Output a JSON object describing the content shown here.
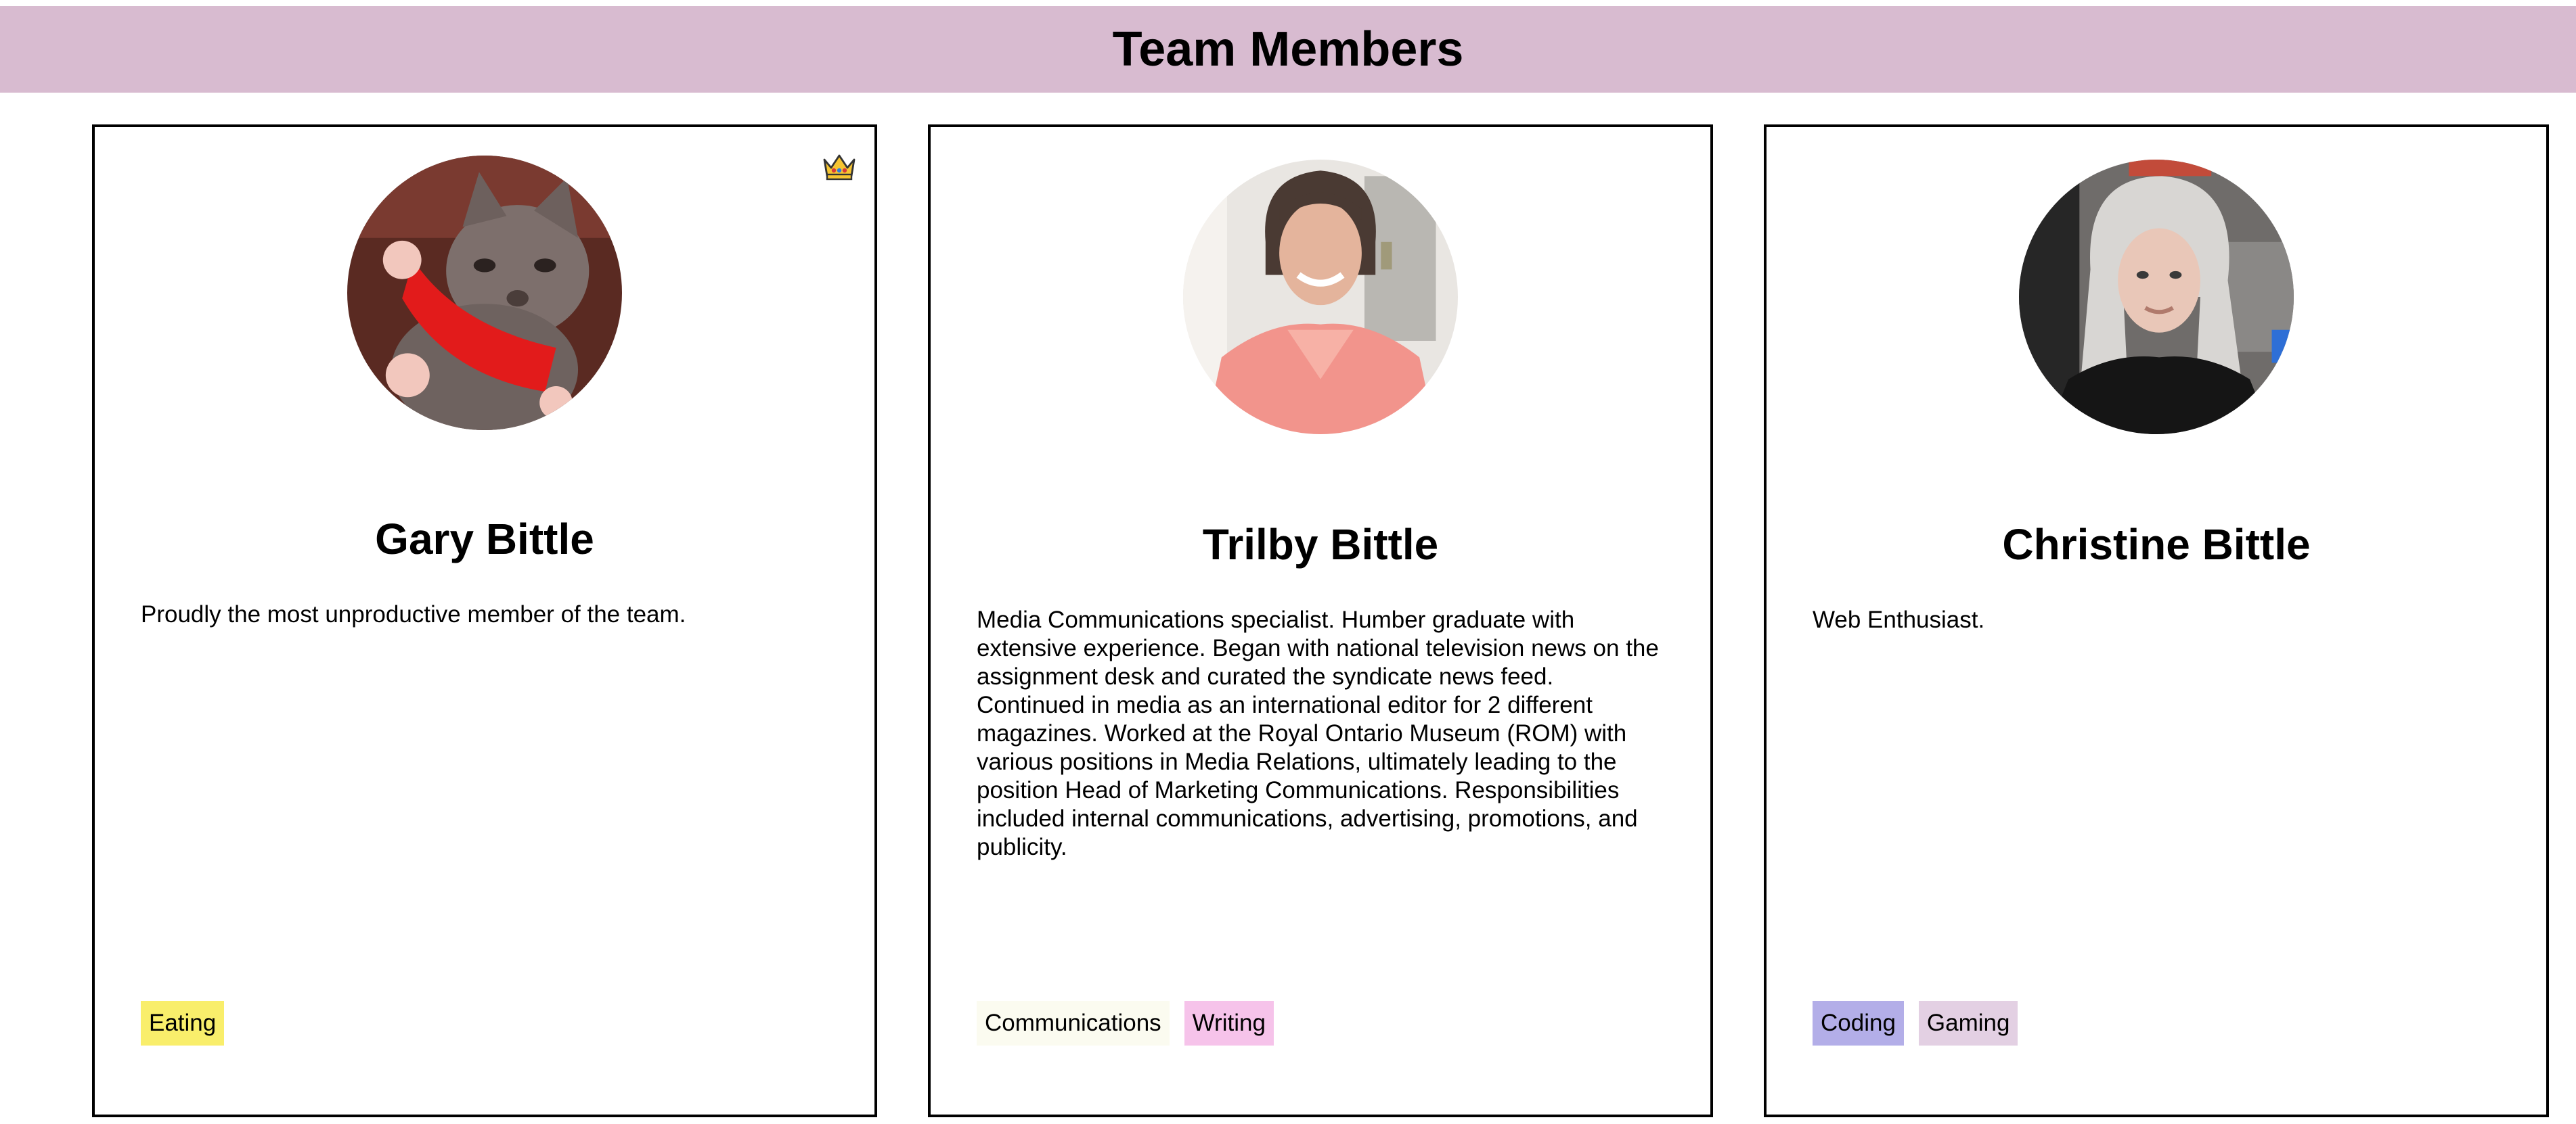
{
  "header": {
    "title": "Team Members"
  },
  "members": [
    {
      "name": "Gary Bittle",
      "bio": "Proudly the most unproductive member of the team.",
      "badge_icon": "crown-icon",
      "photo": "cat-photo",
      "tags": [
        {
          "label": "Eating",
          "color": "#f9ee6b"
        }
      ]
    },
    {
      "name": "Trilby Bittle",
      "bio": "Media Communications specialist. Humber graduate with extensive experience. Began with national television news on the assignment desk and curated the syndicate news feed. Continued in media as an international editor for 2 different magazines. Worked at the Royal Ontario Museum (ROM) with various positions in Media Relations, ultimately leading to the position Head of Marketing Communications. Responsibilities included internal communications, advertising, promotions, and publicity.",
      "photo": "woman-photo",
      "tags": [
        {
          "label": "Communications",
          "color": "#fbfbf0"
        },
        {
          "label": "Writing",
          "color": "#f6c3ea"
        }
      ]
    },
    {
      "name": "Christine Bittle",
      "bio": "Web Enthusiast.",
      "photo": "woman-photo",
      "tags": [
        {
          "label": "Coding",
          "color": "#b3aee8"
        },
        {
          "label": "Gaming",
          "color": "#e3d0e3"
        }
      ]
    }
  ]
}
